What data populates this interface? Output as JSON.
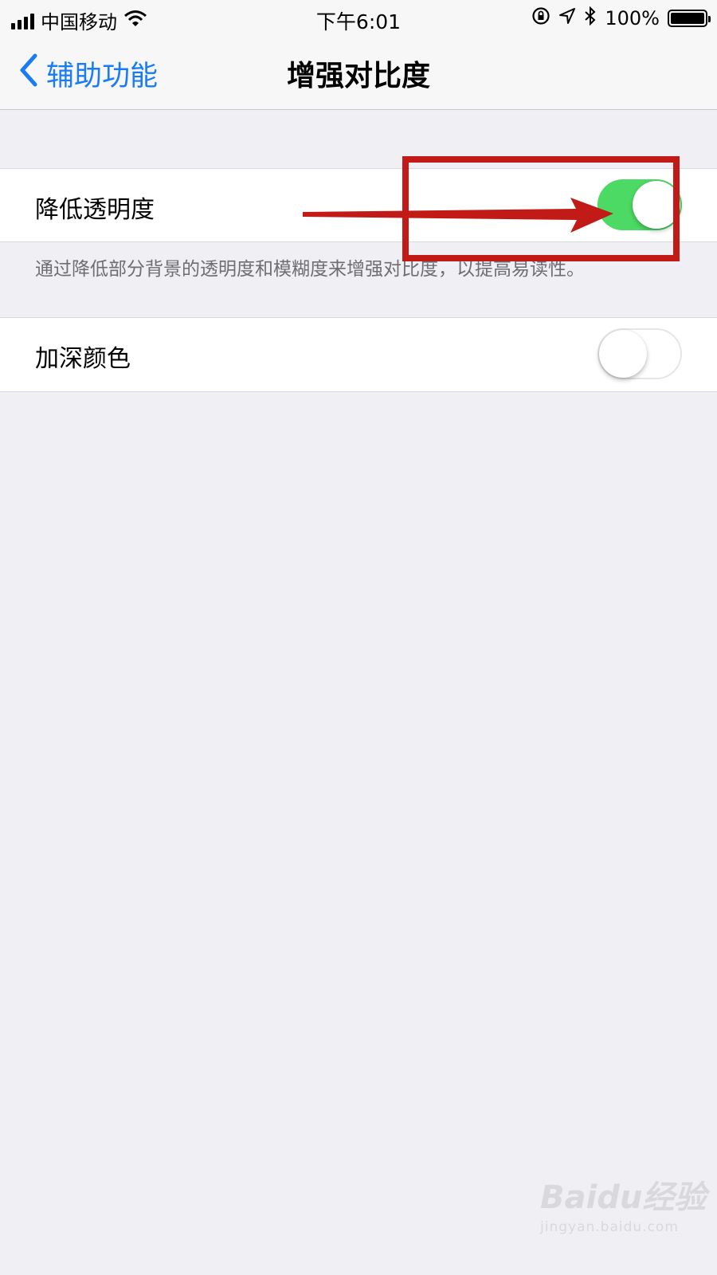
{
  "status_bar": {
    "carrier": "中国移动",
    "time": "下午6:01",
    "battery_percent": "100%",
    "battery_level": 1.0,
    "signal_bars": 4,
    "icons": [
      "signal-icon",
      "wifi-icon",
      "rotation-lock-icon",
      "location-icon",
      "bluetooth-icon",
      "battery-icon"
    ]
  },
  "nav": {
    "back_label": "辅助功能",
    "title": "增强对比度"
  },
  "settings": {
    "reduce_transparency": {
      "label": "降低透明度",
      "enabled": true,
      "footnote": "通过降低部分背景的透明度和模糊度来增强对比度，以提高易读性。"
    },
    "darken_colors": {
      "label": "加深颜色",
      "enabled": false
    }
  },
  "colors": {
    "accent": "#1a7cf5",
    "toggle_on": "#4cd964",
    "annotation": "#c21b17",
    "background": "#efeff4"
  },
  "watermark": {
    "brand": "Baidu经验",
    "url": "jingyan.baidu.com"
  }
}
